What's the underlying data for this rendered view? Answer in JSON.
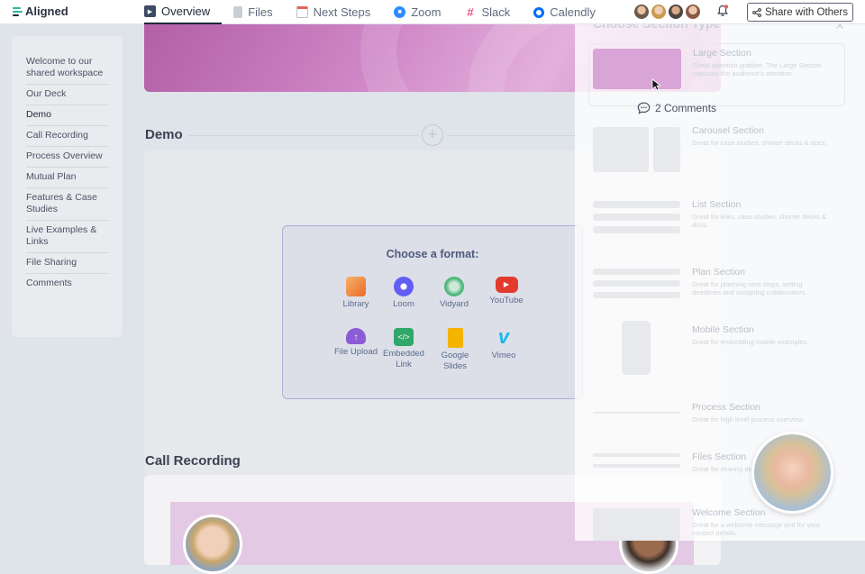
{
  "app": {
    "logo_text": "Aligned",
    "accent": "#2fb59a"
  },
  "tabs": [
    {
      "label": "Overview",
      "icon": "play-icon",
      "active": true
    },
    {
      "label": "Files",
      "icon": "file-icon"
    },
    {
      "label": "Next Steps",
      "icon": "calendar-icon"
    },
    {
      "label": "Zoom",
      "icon": "zoom-icon"
    },
    {
      "label": "Slack",
      "icon": "slack-icon"
    },
    {
      "label": "Calendly",
      "icon": "calendly-icon"
    }
  ],
  "header": {
    "share_label": "Share with Others"
  },
  "sidebar": {
    "items": [
      {
        "label": "Welcome to our shared workspace"
      },
      {
        "label": "Our Deck"
      },
      {
        "label": "Demo"
      },
      {
        "label": "Call Recording"
      },
      {
        "label": "Process Overview"
      },
      {
        "label": "Mutual Plan"
      },
      {
        "label": "Features & Case Studies"
      },
      {
        "label": "Live Examples & Links"
      },
      {
        "label": "File Sharing"
      },
      {
        "label": "Comments"
      }
    ]
  },
  "sections": {
    "demo_title": "Demo",
    "recording_title": "Call Recording"
  },
  "format_picker": {
    "title": "Choose a format:",
    "options": [
      {
        "label": "Library",
        "icon": "library-icon",
        "color": "#f08a3c"
      },
      {
        "label": "Loom",
        "icon": "loom-icon",
        "color": "#625df5"
      },
      {
        "label": "Vidyard",
        "icon": "vidyard-icon",
        "color": "#4bb67a"
      },
      {
        "label": "YouTube",
        "icon": "youtube-icon",
        "color": "#e23b2e"
      },
      {
        "label": "File Upload",
        "icon": "cloud-upload-icon",
        "color": "#8b5cd6"
      },
      {
        "label": "Embedded Link",
        "icon": "code-icon",
        "color": "#2fa86a"
      },
      {
        "label": "Google Slides",
        "icon": "slides-icon",
        "color": "#f4b400"
      },
      {
        "label": "Vimeo",
        "icon": "vimeo-icon",
        "color": "#1ab7ea"
      }
    ]
  },
  "comments": {
    "label": "2 Comments"
  },
  "section_panel": {
    "title": "Choose Section Type",
    "options": [
      {
        "name": "Large Section",
        "desc": "Great attention grabber. The Large Section captures the audience's attention."
      },
      {
        "name": "Carousel Section",
        "desc": "Great for case studies, shorter decks & docs."
      },
      {
        "name": "List Section",
        "desc": "Great for links, case studies, shorter decks & docs."
      },
      {
        "name": "Plan Section",
        "desc": "Great for planning next steps, setting deadlines and assigning collaborators."
      },
      {
        "name": "Mobile Section",
        "desc": "Great for embedding mobile examples."
      },
      {
        "name": "Process Section",
        "desc": "Great for high level process overview."
      },
      {
        "name": "Files Section",
        "desc": "Great for sharing documents."
      },
      {
        "name": "Welcome Section",
        "desc": "Great for a welcome message and for your contact details."
      }
    ]
  }
}
